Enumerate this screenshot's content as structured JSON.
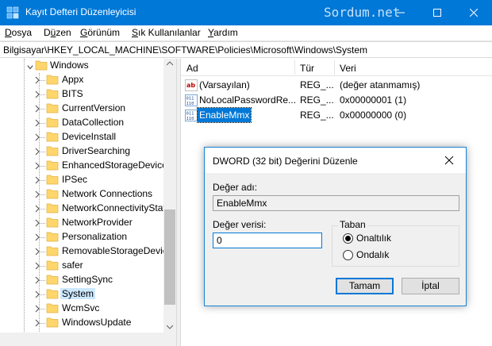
{
  "window": {
    "title": "Kayıt Defteri Düzenleyicisi",
    "watermark": "Sordum.net"
  },
  "menu": {
    "items": [
      {
        "label": "Dosya",
        "accel": "D",
        "rest": "osya"
      },
      {
        "label": "Düzen",
        "accel": "ü",
        "prefix": "D",
        "rest": "zen"
      },
      {
        "label": "Görünüm",
        "accel": "G",
        "rest": "örünüm"
      },
      {
        "label": "Sık Kullanılanlar",
        "accel": "S",
        "rest": "ık Kullanılanlar"
      },
      {
        "label": "Yardım",
        "accel": "Y",
        "rest": "ardım"
      }
    ]
  },
  "address": {
    "path": "Bilgisayar\\HKEY_LOCAL_MACHINE\\SOFTWARE\\Policies\\Microsoft\\Windows\\System"
  },
  "tree": {
    "parent": "Windows",
    "children": [
      "Appx",
      "BITS",
      "CurrentVersion",
      "DataCollection",
      "DeviceInstall",
      "DriverSearching",
      "EnhancedStorageDevices",
      "IPSec",
      "Network Connections",
      "NetworkConnectivityStatusIndicator",
      "NetworkProvider",
      "Personalization",
      "RemovableStorageDevices",
      "safer",
      "SettingSync",
      "System",
      "WcmSvc",
      "WindowsUpdate"
    ],
    "selected": "System"
  },
  "list": {
    "headers": {
      "name": "Ad",
      "type": "Tür",
      "data": "Veri"
    },
    "rows": [
      {
        "name": "(Varsayılan)",
        "type": "REG_...",
        "data": "(değer atanmamış)",
        "icon": "ab"
      },
      {
        "name": "NoLocalPasswordRe...",
        "type": "REG_...",
        "data": "0x00000001 (1)",
        "icon": "dword"
      },
      {
        "name": "EnableMmx",
        "type": "REG_...",
        "data": "0x00000000 (0)",
        "icon": "dword"
      }
    ]
  },
  "dialog": {
    "title": "DWORD (32 bit) Değerini Düzenle",
    "value_name_label": "Değer adı:",
    "value_name": "EnableMmx",
    "value_data_label": "Değer verisi:",
    "value_data": "0",
    "base_label": "Taban",
    "hex_label": "Onaltılık",
    "dec_label": "Ondalık",
    "base_selected": "hex",
    "ok_label": "Tamam",
    "cancel_label": "İptal"
  },
  "colors": {
    "accent": "#0078d7",
    "folder": "#ffd66b",
    "selection": "#cce8ff"
  }
}
